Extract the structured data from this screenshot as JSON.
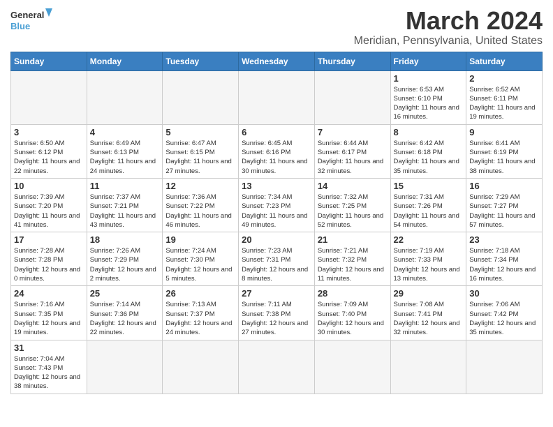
{
  "header": {
    "logo_general": "General",
    "logo_blue": "Blue",
    "title": "March 2024",
    "subtitle": "Meridian, Pennsylvania, United States"
  },
  "weekdays": [
    "Sunday",
    "Monday",
    "Tuesday",
    "Wednesday",
    "Thursday",
    "Friday",
    "Saturday"
  ],
  "weeks": [
    [
      {
        "day": "",
        "info": ""
      },
      {
        "day": "",
        "info": ""
      },
      {
        "day": "",
        "info": ""
      },
      {
        "day": "",
        "info": ""
      },
      {
        "day": "",
        "info": ""
      },
      {
        "day": "1",
        "info": "Sunrise: 6:53 AM\nSunset: 6:10 PM\nDaylight: 11 hours and 16 minutes."
      },
      {
        "day": "2",
        "info": "Sunrise: 6:52 AM\nSunset: 6:11 PM\nDaylight: 11 hours and 19 minutes."
      }
    ],
    [
      {
        "day": "3",
        "info": "Sunrise: 6:50 AM\nSunset: 6:12 PM\nDaylight: 11 hours and 22 minutes."
      },
      {
        "day": "4",
        "info": "Sunrise: 6:49 AM\nSunset: 6:13 PM\nDaylight: 11 hours and 24 minutes."
      },
      {
        "day": "5",
        "info": "Sunrise: 6:47 AM\nSunset: 6:15 PM\nDaylight: 11 hours and 27 minutes."
      },
      {
        "day": "6",
        "info": "Sunrise: 6:45 AM\nSunset: 6:16 PM\nDaylight: 11 hours and 30 minutes."
      },
      {
        "day": "7",
        "info": "Sunrise: 6:44 AM\nSunset: 6:17 PM\nDaylight: 11 hours and 32 minutes."
      },
      {
        "day": "8",
        "info": "Sunrise: 6:42 AM\nSunset: 6:18 PM\nDaylight: 11 hours and 35 minutes."
      },
      {
        "day": "9",
        "info": "Sunrise: 6:41 AM\nSunset: 6:19 PM\nDaylight: 11 hours and 38 minutes."
      }
    ],
    [
      {
        "day": "10",
        "info": "Sunrise: 7:39 AM\nSunset: 7:20 PM\nDaylight: 11 hours and 41 minutes."
      },
      {
        "day": "11",
        "info": "Sunrise: 7:37 AM\nSunset: 7:21 PM\nDaylight: 11 hours and 43 minutes."
      },
      {
        "day": "12",
        "info": "Sunrise: 7:36 AM\nSunset: 7:22 PM\nDaylight: 11 hours and 46 minutes."
      },
      {
        "day": "13",
        "info": "Sunrise: 7:34 AM\nSunset: 7:23 PM\nDaylight: 11 hours and 49 minutes."
      },
      {
        "day": "14",
        "info": "Sunrise: 7:32 AM\nSunset: 7:25 PM\nDaylight: 11 hours and 52 minutes."
      },
      {
        "day": "15",
        "info": "Sunrise: 7:31 AM\nSunset: 7:26 PM\nDaylight: 11 hours and 54 minutes."
      },
      {
        "day": "16",
        "info": "Sunrise: 7:29 AM\nSunset: 7:27 PM\nDaylight: 11 hours and 57 minutes."
      }
    ],
    [
      {
        "day": "17",
        "info": "Sunrise: 7:28 AM\nSunset: 7:28 PM\nDaylight: 12 hours and 0 minutes."
      },
      {
        "day": "18",
        "info": "Sunrise: 7:26 AM\nSunset: 7:29 PM\nDaylight: 12 hours and 2 minutes."
      },
      {
        "day": "19",
        "info": "Sunrise: 7:24 AM\nSunset: 7:30 PM\nDaylight: 12 hours and 5 minutes."
      },
      {
        "day": "20",
        "info": "Sunrise: 7:23 AM\nSunset: 7:31 PM\nDaylight: 12 hours and 8 minutes."
      },
      {
        "day": "21",
        "info": "Sunrise: 7:21 AM\nSunset: 7:32 PM\nDaylight: 12 hours and 11 minutes."
      },
      {
        "day": "22",
        "info": "Sunrise: 7:19 AM\nSunset: 7:33 PM\nDaylight: 12 hours and 13 minutes."
      },
      {
        "day": "23",
        "info": "Sunrise: 7:18 AM\nSunset: 7:34 PM\nDaylight: 12 hours and 16 minutes."
      }
    ],
    [
      {
        "day": "24",
        "info": "Sunrise: 7:16 AM\nSunset: 7:35 PM\nDaylight: 12 hours and 19 minutes."
      },
      {
        "day": "25",
        "info": "Sunrise: 7:14 AM\nSunset: 7:36 PM\nDaylight: 12 hours and 22 minutes."
      },
      {
        "day": "26",
        "info": "Sunrise: 7:13 AM\nSunset: 7:37 PM\nDaylight: 12 hours and 24 minutes."
      },
      {
        "day": "27",
        "info": "Sunrise: 7:11 AM\nSunset: 7:38 PM\nDaylight: 12 hours and 27 minutes."
      },
      {
        "day": "28",
        "info": "Sunrise: 7:09 AM\nSunset: 7:40 PM\nDaylight: 12 hours and 30 minutes."
      },
      {
        "day": "29",
        "info": "Sunrise: 7:08 AM\nSunset: 7:41 PM\nDaylight: 12 hours and 32 minutes."
      },
      {
        "day": "30",
        "info": "Sunrise: 7:06 AM\nSunset: 7:42 PM\nDaylight: 12 hours and 35 minutes."
      }
    ],
    [
      {
        "day": "31",
        "info": "Sunrise: 7:04 AM\nSunset: 7:43 PM\nDaylight: 12 hours and 38 minutes."
      },
      {
        "day": "",
        "info": ""
      },
      {
        "day": "",
        "info": ""
      },
      {
        "day": "",
        "info": ""
      },
      {
        "day": "",
        "info": ""
      },
      {
        "day": "",
        "info": ""
      },
      {
        "day": "",
        "info": ""
      }
    ]
  ]
}
